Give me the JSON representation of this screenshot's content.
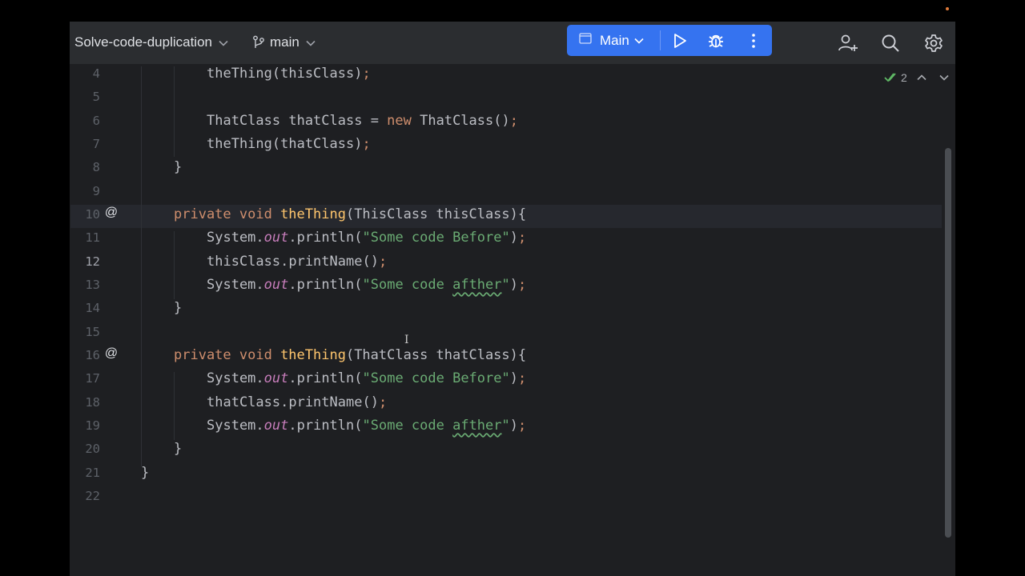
{
  "toolbar": {
    "project_name": "Solve-code-duplication",
    "branch_name": "main",
    "run_config": "Main"
  },
  "inspections": {
    "count": "2"
  },
  "gutter_marker": "@",
  "lines": [
    {
      "num": "4",
      "indent": 2,
      "tokens": [
        [
          "theThing(thisClass)",
          "plain"
        ],
        [
          ";",
          "kw"
        ]
      ]
    },
    {
      "num": "5",
      "indent": 0,
      "tokens": []
    },
    {
      "num": "6",
      "indent": 2,
      "tokens": [
        [
          "ThatClass thatClass = ",
          "plain"
        ],
        [
          "new",
          "kw"
        ],
        [
          " ThatClass()",
          "plain"
        ],
        [
          ";",
          "kw"
        ]
      ]
    },
    {
      "num": "7",
      "indent": 2,
      "tokens": [
        [
          "theThing(thatClass)",
          "plain"
        ],
        [
          ";",
          "kw"
        ]
      ]
    },
    {
      "num": "8",
      "indent": 1,
      "tokens": [
        [
          "}",
          "plain"
        ]
      ]
    },
    {
      "num": "9",
      "indent": 0,
      "tokens": []
    },
    {
      "num": "10",
      "indent": 1,
      "marker": true,
      "tokens": [
        [
          "private void ",
          "kw"
        ],
        [
          "theThing",
          "def"
        ],
        [
          "(ThisClass thisClass){",
          "plain"
        ]
      ]
    },
    {
      "num": "11",
      "indent": 2,
      "tokens": [
        [
          "System.",
          "plain"
        ],
        [
          "out",
          "it"
        ],
        [
          ".println(",
          "plain"
        ],
        [
          "\"Some code Before\"",
          "st"
        ],
        [
          ")",
          "plain"
        ],
        [
          ";",
          "kw"
        ]
      ]
    },
    {
      "num": "12",
      "indent": 2,
      "current": true,
      "tokens": [
        [
          "thisClass.printName()",
          "plain"
        ],
        [
          ";",
          "kw"
        ]
      ]
    },
    {
      "num": "13",
      "indent": 2,
      "tokens": [
        [
          "System.",
          "plain"
        ],
        [
          "out",
          "it"
        ],
        [
          ".println(",
          "plain"
        ],
        [
          "\"Some code ",
          "st"
        ],
        [
          "afther",
          "st typo"
        ],
        [
          "\"",
          "st"
        ],
        [
          ")",
          "plain"
        ],
        [
          ";",
          "kw"
        ]
      ]
    },
    {
      "num": "14",
      "indent": 1,
      "tokens": [
        [
          "}",
          "plain"
        ]
      ]
    },
    {
      "num": "15",
      "indent": 0,
      "tokens": []
    },
    {
      "num": "16",
      "indent": 1,
      "marker": true,
      "tokens": [
        [
          "private void ",
          "kw"
        ],
        [
          "theThing",
          "def"
        ],
        [
          "(ThatClass thatClass){",
          "plain"
        ]
      ]
    },
    {
      "num": "17",
      "indent": 2,
      "tokens": [
        [
          "System.",
          "plain"
        ],
        [
          "out",
          "it"
        ],
        [
          ".println(",
          "plain"
        ],
        [
          "\"Some code Before\"",
          "st"
        ],
        [
          ")",
          "plain"
        ],
        [
          ";",
          "kw"
        ]
      ]
    },
    {
      "num": "18",
      "indent": 2,
      "tokens": [
        [
          "thatClass.printName()",
          "plain"
        ],
        [
          ";",
          "kw"
        ]
      ]
    },
    {
      "num": "19",
      "indent": 2,
      "tokens": [
        [
          "System.",
          "plain"
        ],
        [
          "out",
          "it"
        ],
        [
          ".println(",
          "plain"
        ],
        [
          "\"Some code ",
          "st"
        ],
        [
          "afther",
          "st typo"
        ],
        [
          "\"",
          "st"
        ],
        [
          ")",
          "plain"
        ],
        [
          ";",
          "kw"
        ]
      ]
    },
    {
      "num": "20",
      "indent": 1,
      "tokens": [
        [
          "}",
          "plain"
        ]
      ]
    },
    {
      "num": "21",
      "indent": 0,
      "tokens": [
        [
          "}",
          "plain"
        ]
      ]
    },
    {
      "num": "22",
      "indent": 0,
      "tokens": []
    }
  ]
}
